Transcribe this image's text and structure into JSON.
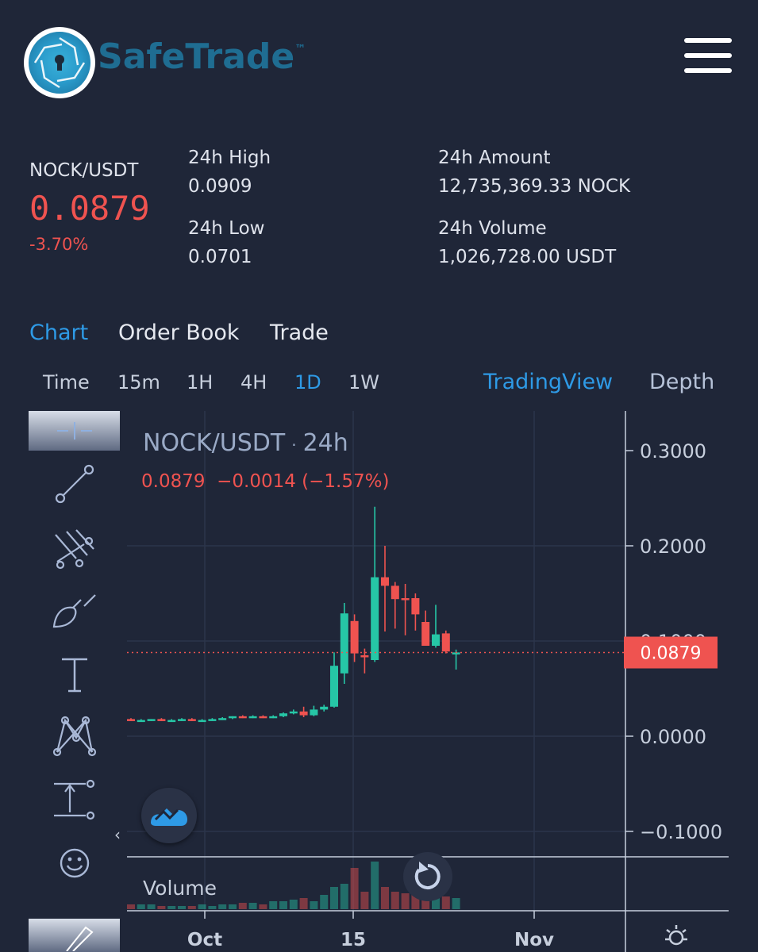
{
  "header": {
    "brand": "SafeTrade",
    "trademark": "™"
  },
  "ticker": {
    "pair": "NOCK/USDT",
    "last_price": "0.0879",
    "change_pct": "-3.70%",
    "high_label": "24h High",
    "high_value": "0.0909",
    "low_label": "24h Low",
    "low_value": "0.0701",
    "amount_label": "24h Amount",
    "amount_value": "12,735,369.33 NOCK",
    "volume_label": "24h Volume",
    "volume_value": "1,026,728.00 USDT"
  },
  "tabs": [
    {
      "label": "Chart",
      "active": true
    },
    {
      "label": "Order Book",
      "active": false
    },
    {
      "label": "Trade",
      "active": false
    }
  ],
  "intervals": [
    {
      "label": "Time",
      "active": false
    },
    {
      "label": "15m",
      "active": false
    },
    {
      "label": "1H",
      "active": false
    },
    {
      "label": "4H",
      "active": false
    },
    {
      "label": "1D",
      "active": true
    },
    {
      "label": "1W",
      "active": false
    }
  ],
  "views": {
    "tradingview": "TradingView",
    "depth": "Depth"
  },
  "legend": {
    "symbol": "NOCK/USDT",
    "separator": "·",
    "resolution": "24h",
    "ohlc": "0.0879  −0.0014 (−1.57%)"
  },
  "volume_label": "Volume",
  "colors": {
    "up": "#26c6a6",
    "down": "#ef5350",
    "accent": "#2e9ae6",
    "background": "#1f2638"
  },
  "icons": [
    "crosshair-icon",
    "trend-line-icon",
    "fib-icon",
    "brush-icon",
    "text-icon",
    "pattern-icon",
    "measure-icon",
    "emoji-icon",
    "ruler-icon",
    "tradingview-logo-icon",
    "reset-icon",
    "settings-icon"
  ],
  "chart_data": {
    "type": "candlestick",
    "y_ticks": [
      "0.3000",
      "0.2000",
      "0.1000",
      "0.0000",
      "−0.1000"
    ],
    "x_ticks": [
      "Oct",
      "15",
      "Nov"
    ],
    "ylim": [
      -0.1,
      0.3
    ],
    "current_price_label": "0.0879",
    "candles": [
      {
        "o": 0.018,
        "h": 0.019,
        "l": 0.016,
        "c": 0.017
      },
      {
        "o": 0.017,
        "h": 0.018,
        "l": 0.016,
        "c": 0.017
      },
      {
        "o": 0.017,
        "h": 0.018,
        "l": 0.016,
        "c": 0.018
      },
      {
        "o": 0.018,
        "h": 0.019,
        "l": 0.016,
        "c": 0.017
      },
      {
        "o": 0.017,
        "h": 0.018,
        "l": 0.016,
        "c": 0.017
      },
      {
        "o": 0.017,
        "h": 0.019,
        "l": 0.016,
        "c": 0.018
      },
      {
        "o": 0.018,
        "h": 0.019,
        "l": 0.016,
        "c": 0.017
      },
      {
        "o": 0.017,
        "h": 0.018,
        "l": 0.016,
        "c": 0.017
      },
      {
        "o": 0.017,
        "h": 0.019,
        "l": 0.016,
        "c": 0.018
      },
      {
        "o": 0.018,
        "h": 0.02,
        "l": 0.017,
        "c": 0.019
      },
      {
        "o": 0.019,
        "h": 0.021,
        "l": 0.018,
        "c": 0.021
      },
      {
        "o": 0.021,
        "h": 0.022,
        "l": 0.019,
        "c": 0.02
      },
      {
        "o": 0.02,
        "h": 0.022,
        "l": 0.019,
        "c": 0.021
      },
      {
        "o": 0.021,
        "h": 0.022,
        "l": 0.019,
        "c": 0.02
      },
      {
        "o": 0.02,
        "h": 0.022,
        "l": 0.019,
        "c": 0.021
      },
      {
        "o": 0.021,
        "h": 0.025,
        "l": 0.02,
        "c": 0.024
      },
      {
        "o": 0.024,
        "h": 0.028,
        "l": 0.023,
        "c": 0.026
      },
      {
        "o": 0.026,
        "h": 0.031,
        "l": 0.02,
        "c": 0.022
      },
      {
        "o": 0.022,
        "h": 0.032,
        "l": 0.021,
        "c": 0.028
      },
      {
        "o": 0.028,
        "h": 0.033,
        "l": 0.026,
        "c": 0.031
      },
      {
        "o": 0.031,
        "h": 0.088,
        "l": 0.03,
        "c": 0.074
      },
      {
        "o": 0.066,
        "h": 0.14,
        "l": 0.055,
        "c": 0.129
      },
      {
        "o": 0.121,
        "h": 0.128,
        "l": 0.078,
        "c": 0.087
      },
      {
        "o": 0.085,
        "h": 0.092,
        "l": 0.066,
        "c": 0.084
      },
      {
        "o": 0.08,
        "h": 0.241,
        "l": 0.078,
        "c": 0.167
      },
      {
        "o": 0.167,
        "h": 0.2,
        "l": 0.11,
        "c": 0.158
      },
      {
        "o": 0.158,
        "h": 0.162,
        "l": 0.113,
        "c": 0.144
      },
      {
        "o": 0.145,
        "h": 0.16,
        "l": 0.106,
        "c": 0.144
      },
      {
        "o": 0.145,
        "h": 0.15,
        "l": 0.111,
        "c": 0.128
      },
      {
        "o": 0.12,
        "h": 0.132,
        "l": 0.098,
        "c": 0.095
      },
      {
        "o": 0.095,
        "h": 0.138,
        "l": 0.093,
        "c": 0.107
      },
      {
        "o": 0.108,
        "h": 0.111,
        "l": 0.087,
        "c": 0.089
      },
      {
        "o": 0.088,
        "h": 0.091,
        "l": 0.07,
        "c": 0.088
      }
    ],
    "volumes": [
      3,
      3,
      3,
      2,
      2,
      2,
      2,
      3,
      2,
      3,
      3,
      4,
      4,
      3,
      5,
      5,
      6,
      7,
      5,
      9,
      14,
      16,
      26,
      11,
      30,
      14,
      11,
      10,
      9,
      8,
      8,
      8,
      7
    ]
  }
}
